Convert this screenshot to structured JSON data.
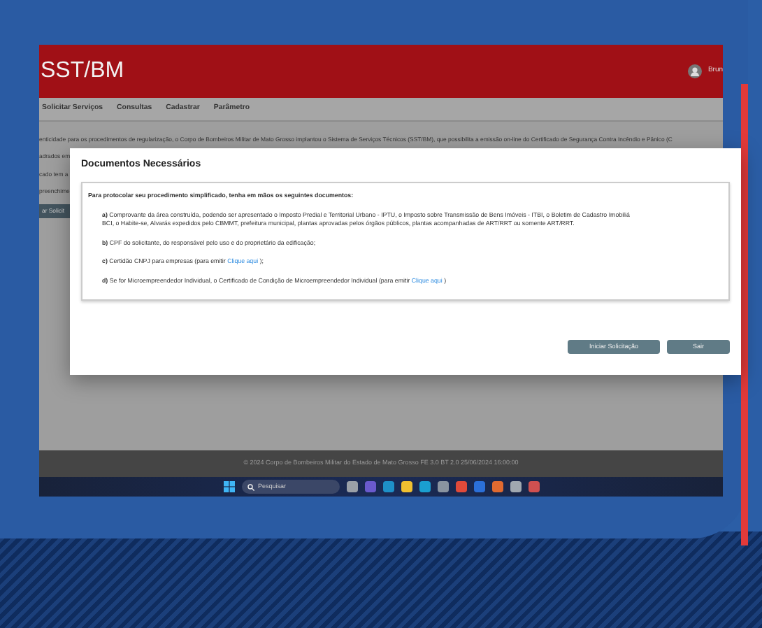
{
  "app": {
    "title": "SST/BM",
    "user": "Brun"
  },
  "nav": [
    {
      "label": "Solicitar Serviços"
    },
    {
      "label": "Consultas"
    },
    {
      "label": "Cadastrar"
    },
    {
      "label": "Parâmetro"
    }
  ],
  "background_text": [
    "enticidade para os procedimentos de regularização, o Corpo de Bombeiros Militar de Mato Grosso implantou o Sistema de Serviços Técnicos (SST/BM), que possibilita a emissão on-line do Certificado de Segurança Contra Incêndio e Pânico (C",
    "adrados em",
    "cado tem a",
    "preenchime"
  ],
  "background_button": "ar Solicit",
  "modal": {
    "title": "Documentos Necessários",
    "intro": "Para protocolar seu procedimento simplificado, tenha em mãos os seguintes documentos:",
    "items": [
      {
        "lines": [
          "**a)** Comprovante da área construída, podendo ser apresentado o Imposto Predial e Territorial Urbano - IPTU, o Imposto sobre Transmissão de Bens Imóveis - ITBI, o Boletim de Cadastro Imobiliá",
          "BCI, o Habite-se, Alvarás expedidos pelo CBMMT, prefeitura municipal, plantas aprovadas pelos órgãos públicos, plantas acompanhadas de ART/RRT ou somente ART/RRT."
        ]
      },
      {
        "lines": [
          "**b)** CPF do solicitante, do responsável pelo uso e do proprietário da edificação;"
        ]
      },
      {
        "lines": [
          "**c)** Certidão CNPJ para empresas (para emitir"
        ],
        "link": "Clique aqui",
        "after": ");"
      },
      {
        "lines": [
          "**d)** Se for Microempreendedor Individual, o Certificado de Condição de Microempreendedor Individual (para emitir"
        ],
        "link": "Clique aqui",
        "after": ")"
      }
    ],
    "buttons": [
      "Iniciar Solicitação",
      "Sair"
    ]
  },
  "footer": "© 2024 Corpo de Bombeiros Militar do Estado de Mato Grosso FE 3.0 BT 2.0 25/06/2024 16:00:00",
  "taskbar": {
    "search_placeholder": "Pesquisar"
  }
}
